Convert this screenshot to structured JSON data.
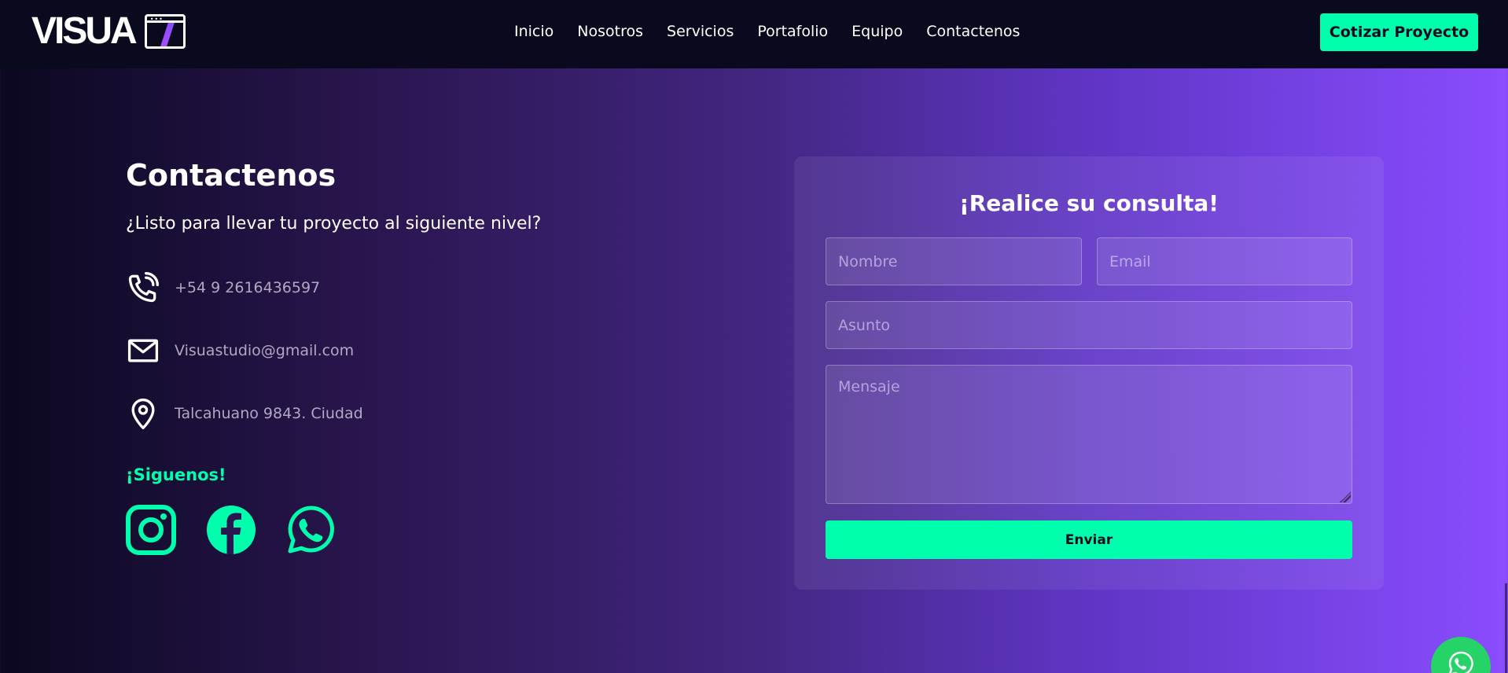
{
  "header": {
    "logo_text": "VISUA",
    "nav": [
      {
        "label": "Inicio"
      },
      {
        "label": "Nosotros"
      },
      {
        "label": "Servicios"
      },
      {
        "label": "Portafolio"
      },
      {
        "label": "Equipo"
      },
      {
        "label": "Contactenos"
      }
    ],
    "cta_label": "Cotizar Proyecto"
  },
  "contact": {
    "title": "Contactenos",
    "subtitle": "¿Listo para llevar tu proyecto al siguiente nivel?",
    "phone": {
      "icon": "phone-icon",
      "text": "+54 9 2616436597"
    },
    "email": {
      "icon": "mail-icon",
      "text": "Visuastudio@gmail.com"
    },
    "address": {
      "icon": "location-pin-icon",
      "text": "Talcahuano 9843. Ciudad"
    },
    "follow_label": "¡Siguenos!",
    "socials": [
      {
        "icon": "instagram-icon"
      },
      {
        "icon": "facebook-icon"
      },
      {
        "icon": "whatsapp-icon"
      }
    ]
  },
  "form": {
    "title": "¡Realice su consulta!",
    "name_placeholder": "Nombre",
    "email_placeholder": "Email",
    "subject_placeholder": "Asunto",
    "message_placeholder": "Mensaje",
    "submit_label": "Enviar"
  },
  "floating": {
    "icon": "whatsapp-icon"
  },
  "colors": {
    "accent": "#00ffad",
    "nav_bg": "#0a0a1e",
    "gradient_end": "#8a4cff",
    "whatsapp": "#25d366"
  }
}
